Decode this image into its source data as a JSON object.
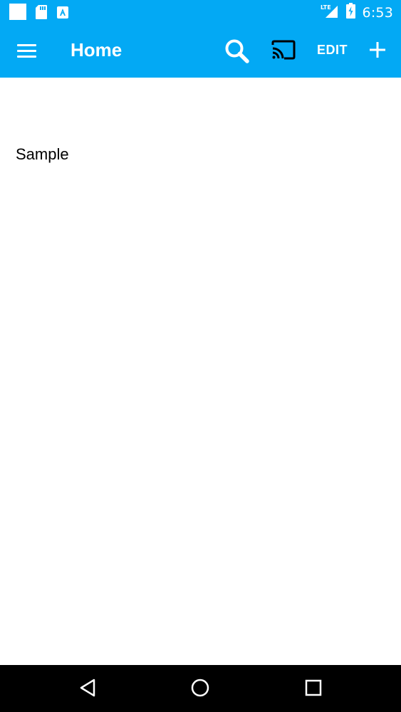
{
  "status_bar": {
    "time": "6:53",
    "network": "LTE",
    "left_icons": [
      "notification-square-icon",
      "sd-card-icon",
      "app-store-icon"
    ],
    "right_icons": [
      "lte-signal-icon",
      "battery-charging-icon"
    ]
  },
  "app_bar": {
    "title": "Home",
    "edit_label": "EDIT",
    "icons": [
      "menu-icon",
      "search-icon",
      "cast-icon",
      "add-icon"
    ],
    "background": "#03a9f4"
  },
  "content": {
    "sample_text": "Sample"
  },
  "nav_bar": {
    "icons": [
      "back-icon",
      "home-icon",
      "recents-icon"
    ]
  }
}
